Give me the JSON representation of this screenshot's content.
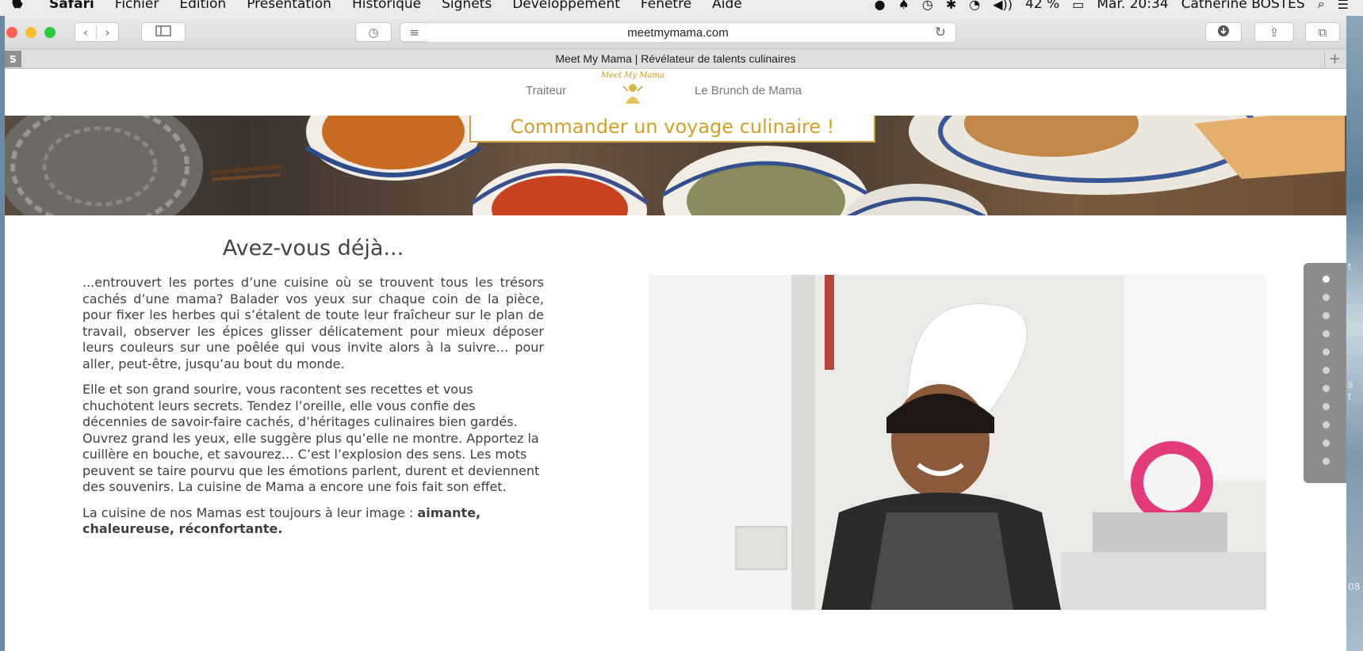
{
  "menubar": {
    "app_name": "Safari",
    "items": [
      "Fichier",
      "Édition",
      "Présentation",
      "Historique",
      "Signets",
      "Développement",
      "Fenêtre",
      "Aide"
    ],
    "battery": "42 %",
    "clock": "Mar. 20:34",
    "user": "Catherine BOSTES"
  },
  "browser": {
    "url": "meetmymama.com",
    "tab_title": "Meet My Mama | Révélateur de talents culinaires",
    "tab_side_label": "S"
  },
  "site": {
    "nav_left": "Traiteur",
    "nav_right": "Le Brunch de Mama",
    "logo_text": "Meet My Mama",
    "cta": "Commander un voyage culinaire !",
    "heading": "Avez-vous déjà...",
    "p1": "...entrouvert les portes d’une cuisine où se trouvent tous les trésors cachés d’une mama? Balader vos yeux sur chaque coin de la pièce, pour fixer les herbes qui s’étalent de toute leur fraîcheur sur le plan de travail, observer les épices glisser délicatement pour mieux déposer leurs couleurs sur une poêlée qui vous invite alors à la suivre… pour aller, peut-être, jusqu’au bout du monde.",
    "p2": " Elle et son grand sourire, vous racontent ses recettes et vous chuchotent leurs secrets. Tendez l’oreille, elle vous confie des décennies de savoir-faire cachés, d’héritages culinaires bien gardés. Ouvrez grand les yeux, elle suggère plus qu’elle ne montre. Apportez la cuillère en bouche, et savourez… C’est l’explosion des sens. Les mots peuvent se taire pourvu que les émotions parlent, durent et deviennent des souvenirs. La cuisine de Mama a encore une fois fait son effet.",
    "p3_plain": "La cuisine de nos Mamas est toujours à leur image : ",
    "p3_bold": "aimante, chaleureuse, réconfortante."
  },
  "wallpaper_fragments": [
    "t",
    "s",
    "t",
    "08"
  ],
  "colors": {
    "accent_gold": "#d1a02b",
    "text_gray": "#3f3f3f",
    "dot_active": "#ffffff",
    "dot_inactive": "#d4d4d4"
  },
  "section_nav": {
    "dot_count": 11,
    "active_index": 0
  }
}
